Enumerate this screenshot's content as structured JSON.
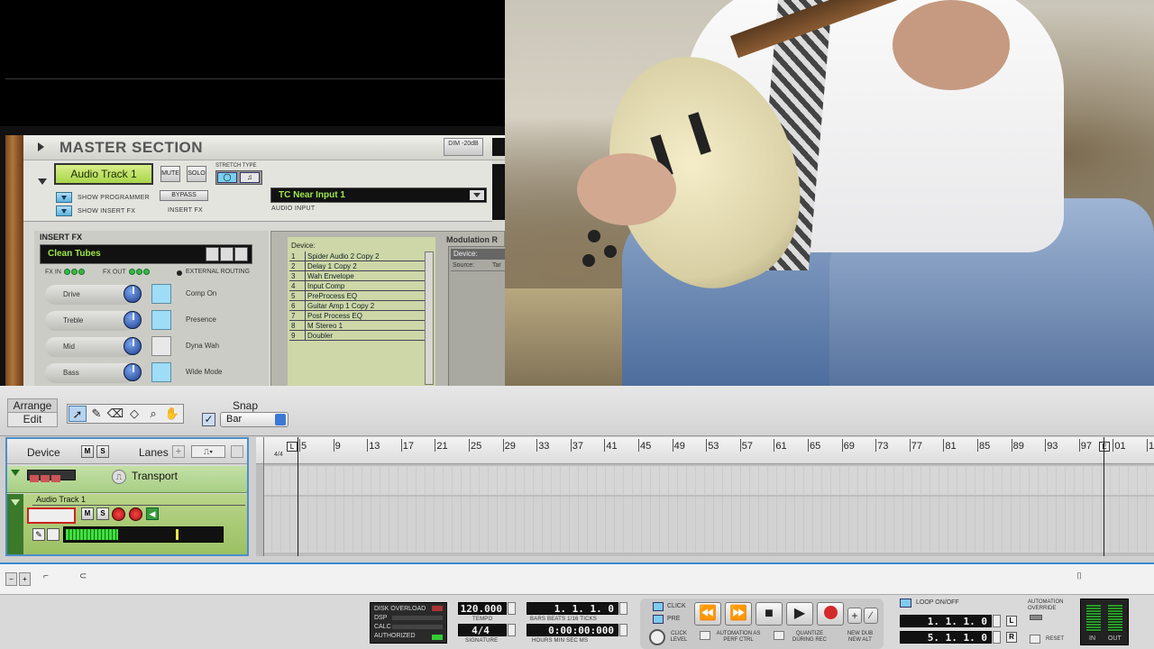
{
  "master": {
    "title": "MASTER SECTION",
    "dim_label": "DIM -20dB",
    "track_name": "Audio Track 1",
    "mute": "MUTE",
    "solo": "SOLO",
    "stretch_type": "STRETCH TYPE",
    "show_programmer": "SHOW PROGRAMMER",
    "show_insert_fx": "SHOW INSERT FX",
    "bypass": "BYPASS",
    "insert_fx_small": "INSERT FX",
    "audio_input_value": "TC Near Input 1",
    "audio_input_label": "AUDIO INPUT"
  },
  "insert_fx": {
    "title": "INSERT FX",
    "patch": "Clean Tubes",
    "fx_in": "FX IN",
    "fx_out": "FX OUT",
    "external_routing": "EXTERNAL ROUTING",
    "rows": [
      {
        "knob": "Drive",
        "button": "Comp On"
      },
      {
        "knob": "Treble",
        "button": "Presence"
      },
      {
        "knob": "Mid",
        "button": "Dyna Wah"
      },
      {
        "knob": "Bass",
        "button": "Wide Mode"
      }
    ]
  },
  "device_panel": {
    "label": "Device:",
    "items": [
      {
        "num": "1",
        "name": "Spider Audio 2 Copy 2"
      },
      {
        "num": "2",
        "name": "Delay 1 Copy 2"
      },
      {
        "num": "3",
        "name": "Wah Envelope"
      },
      {
        "num": "4",
        "name": "Input Comp"
      },
      {
        "num": "5",
        "name": "PreProcess EQ"
      },
      {
        "num": "6",
        "name": "Guitar Amp 1 Copy 2"
      },
      {
        "num": "7",
        "name": "Post Process EQ"
      },
      {
        "num": "8",
        "name": "M Stereo 1"
      },
      {
        "num": "9",
        "name": "Doubler"
      }
    ],
    "modulation_title": "Modulation R",
    "mod_device": "Device:",
    "mod_source": "Source:",
    "mod_target": "Tar"
  },
  "toolbar": {
    "arrange": "Arrange",
    "edit": "Edit",
    "snap": "Snap",
    "snap_value": "Bar"
  },
  "track_panel": {
    "device": "Device",
    "m": "M",
    "s": "S",
    "lanes": "Lanes",
    "transport": "Transport",
    "audio_track": "Audio Track 1",
    "meter_level": 0.34
  },
  "ruler": {
    "signature": "4/4",
    "left_loc": "L",
    "end_loc": "E",
    "ticks": [
      "5",
      "9",
      "13",
      "17",
      "21",
      "25",
      "29",
      "33",
      "37",
      "41",
      "45",
      "49",
      "53",
      "57",
      "61",
      "65",
      "69",
      "73",
      "77",
      "81",
      "85",
      "89",
      "93",
      "97",
      "01",
      "10"
    ]
  },
  "transport": {
    "disk_overload": "DISK OVERLOAD",
    "dsp": "DSP",
    "calc": "CALC",
    "authorized": "AUTHORIZED",
    "tempo": "120.000",
    "tempo_label": "TEMPO",
    "signature": "4/4",
    "signature_label": "SIGNATURE",
    "position": "1.  1.  1.   0",
    "position_label": "BARS BEATS 1/16 TICKS",
    "time": "0:00:00:000",
    "time_label": "HOURS  MIN  SEC   MS",
    "click": "CLICK",
    "pre": "PRE",
    "click_level": "CLICK LEVEL",
    "auto_perf": "AUTOMATION AS PERF CTRL",
    "quantize": "QUANTIZE DURING REC",
    "new_dub": "NEW DUB",
    "new_alt": "NEW ALT",
    "loop": "LOOP ON/OFF",
    "loop_left": "1.  1.  1.   0",
    "loop_right": "5.  1.  1.   0",
    "l": "L",
    "r": "R",
    "auto_override": "AUTOMATION OVERRIDE",
    "reset": "RESET",
    "in": "IN",
    "out": "OUT",
    "rewind": "⏪",
    "ffwd": "⏩",
    "stop": "■",
    "play": "▶"
  }
}
